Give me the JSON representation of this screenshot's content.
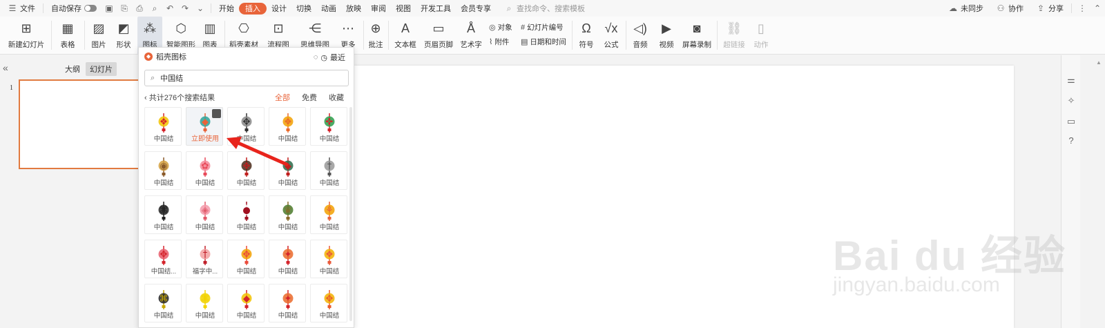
{
  "menubar": {
    "file": "文件",
    "autosave": "自动保存",
    "tabs": [
      "开始",
      "插入",
      "设计",
      "切换",
      "动画",
      "放映",
      "审阅",
      "视图",
      "开发工具",
      "会员专享"
    ],
    "search_placeholder": "查找命令、搜索模板",
    "right": [
      "未同步",
      "协作",
      "分享"
    ]
  },
  "ribbon": {
    "new_slide": "新建幻灯片",
    "table": "表格",
    "picture": "图片",
    "shape": "形状",
    "icon": "图标",
    "smart_graphic": "智能图形",
    "chart": "图表",
    "docer_material": "稻壳素材",
    "flowchart": "流程图",
    "mindmap": "思维导图",
    "more": "更多",
    "comment": "批注",
    "textbox": "文本框",
    "header_footer": "页眉页脚",
    "art_text": "艺术字",
    "object": "对象",
    "attachment": "附件",
    "slide_number": "幻灯片编号",
    "datetime": "日期和时间",
    "symbol": "符号",
    "formula": "公式",
    "audio": "音频",
    "video": "视频",
    "screen_record": "屏幕录制",
    "hyperlink": "超链接",
    "action": "动作"
  },
  "leftpanel": {
    "tab_outline": "大纲",
    "tab_slides": "幻灯片",
    "slide_number": "1"
  },
  "popup": {
    "title": "稻壳图标",
    "recent": "最近",
    "search_value": "中国结",
    "result_count": "共计276个搜索结果",
    "filters": [
      "全部",
      "免费",
      "收藏"
    ],
    "use_now": "立即使用",
    "cells": [
      {
        "caption": "中国结",
        "color": "#d4232a",
        "glyph": "❖",
        "accent": "#f2c200"
      },
      {
        "caption": "立即使用",
        "color": "#e8643a",
        "glyph": "◆",
        "accent": "#2ba39a"
      },
      {
        "caption": "中国结",
        "color": "#333333",
        "glyph": "✥",
        "accent": "#888888"
      },
      {
        "caption": "中国结",
        "color": "#ea6a2a",
        "glyph": "❖",
        "accent": "#f2a000"
      },
      {
        "caption": "中国结",
        "color": "#d4232a",
        "glyph": "✜",
        "accent": "#2a9d4a"
      },
      {
        "caption": "中国结",
        "color": "#8a5a2a",
        "glyph": "◉",
        "accent": "#d4a040"
      },
      {
        "caption": "中国结",
        "color": "#e84a5a",
        "glyph": "✿",
        "accent": "#f58a9a"
      },
      {
        "caption": "中国结",
        "color": "#c0201f",
        "glyph": "✥",
        "accent": "#4a2a1a"
      },
      {
        "caption": "中国结",
        "color": "#c0201f",
        "glyph": "◆",
        "accent": "#2a6a4a"
      },
      {
        "caption": "中国结",
        "color": "#555555",
        "glyph": "†",
        "accent": "#999999"
      },
      {
        "caption": "中国结",
        "color": "#222222",
        "glyph": "⌘",
        "accent": "#222222"
      },
      {
        "caption": "中国结",
        "color": "#e05a6a",
        "glyph": "◈",
        "accent": "#f59aaa"
      },
      {
        "caption": "中国结",
        "color": "#a01020",
        "glyph": "●",
        "accent": "#ffffff"
      },
      {
        "caption": "中国结",
        "color": "#8a6a2a",
        "glyph": "♛",
        "accent": "#4a7a2a"
      },
      {
        "caption": "中国结",
        "color": "#e8643a",
        "glyph": "⚘",
        "accent": "#f2a000"
      },
      {
        "caption": "中国结...",
        "color": "#d4232a",
        "glyph": "✥",
        "accent": "#e85a6a"
      },
      {
        "caption": "福字中...",
        "color": "#c0202a",
        "glyph": "†",
        "accent": "#f2a0a0"
      },
      {
        "caption": "中国结",
        "color": "#ea4a3a",
        "glyph": "✥",
        "accent": "#f2a000"
      },
      {
        "caption": "中国结",
        "color": "#d4232a",
        "glyph": "✦",
        "accent": "#ea6a2a"
      },
      {
        "caption": "中国结",
        "color": "#ea5a3a",
        "glyph": "❖",
        "accent": "#f2b000"
      },
      {
        "caption": "中国结",
        "color": "#c8a800",
        "glyph": "⌘",
        "accent": "#222222"
      },
      {
        "caption": "中国结",
        "color": "#f2d200",
        "glyph": "⌘",
        "accent": "#f2d200"
      },
      {
        "caption": "中国结",
        "color": "#d4232a",
        "glyph": "◆",
        "accent": "#f2c200"
      },
      {
        "caption": "中国结",
        "color": "#d4232a",
        "glyph": "✦",
        "accent": "#ea6a2a"
      },
      {
        "caption": "中国结",
        "color": "#ea5a2a",
        "glyph": "✥",
        "accent": "#f2b000"
      }
    ]
  },
  "watermark": {
    "big": "Bai du 经验",
    "small": "jingyan.baidu.com"
  }
}
